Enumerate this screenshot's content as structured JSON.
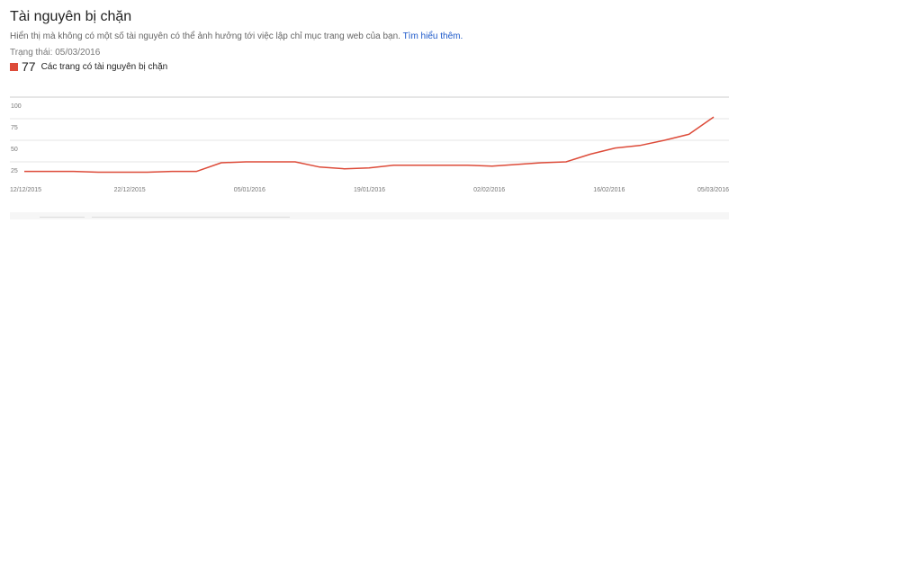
{
  "header": {
    "title": "Tài nguyên bị chặn",
    "description": "Hiển thị mà không có một số tài nguyên có thể ảnh hưởng tới việc lập chỉ mục trang web của bạn.",
    "learn_more": "Tìm hiểu thêm.",
    "status": "Trạng thái:  05/03/2016"
  },
  "legend": {
    "count": "77",
    "label": "Các trang có tài nguyên bị chặn",
    "color": "#dd4b39"
  },
  "chart_data": {
    "type": "line",
    "series": [
      {
        "name": "Các trang có tài nguyên bị chặn",
        "color": "#dd4b39",
        "x": [
          "12/12/2015",
          "15/12/2015",
          "18/12/2015",
          "21/12/2015",
          "24/12/2015",
          "27/12/2015",
          "30/12/2015",
          "02/01/2016",
          "05/01/2016",
          "08/01/2016",
          "11/01/2016",
          "14/01/2016",
          "17/01/2016",
          "20/01/2016",
          "23/01/2016",
          "26/01/2016",
          "29/01/2016",
          "01/02/2016",
          "04/02/2016",
          "07/02/2016",
          "10/02/2016",
          "13/02/2016",
          "16/02/2016",
          "19/02/2016",
          "22/02/2016",
          "25/02/2016",
          "28/02/2016",
          "02/03/2016",
          "05/03/2016"
        ],
        "values": [
          14,
          14,
          14,
          13,
          13,
          13,
          14,
          14,
          24,
          25,
          25,
          25,
          19,
          17,
          18,
          21,
          21,
          21,
          21,
          20,
          22,
          24,
          25,
          34,
          41,
          44,
          50,
          57,
          77
        ]
      }
    ],
    "x_ticks": [
      "12/12/2015",
      "22/12/2015",
      "05/01/2016",
      "19/01/2016",
      "02/02/2016",
      "16/02/2016",
      "05/03/2016"
    ],
    "y_ticks": [
      "100",
      "75",
      "50",
      "25"
    ],
    "ylim": [
      0,
      100
    ],
    "grid": true
  }
}
